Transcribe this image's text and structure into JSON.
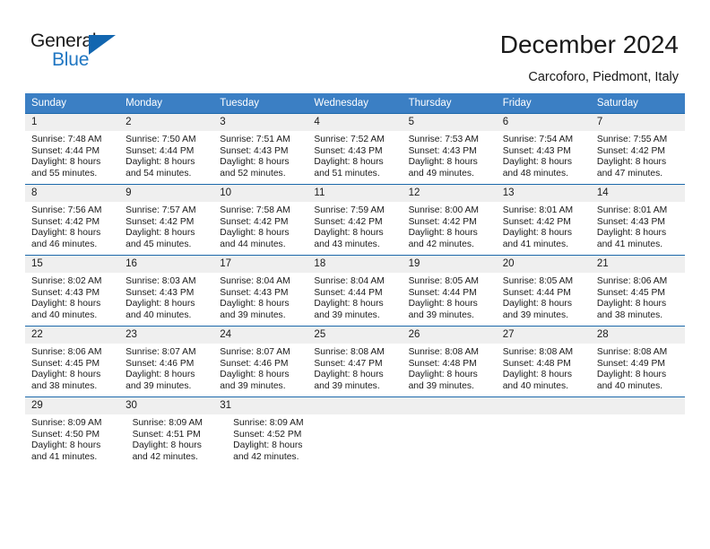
{
  "brand": {
    "word_one": "General",
    "word_two": "Blue",
    "triangle_icon": "triangle-icon",
    "accent_color": "#1266b0"
  },
  "header": {
    "title": "December 2024",
    "subtitle": "Carcoforo, Piedmont, Italy"
  },
  "calendar": {
    "header_bg": "#3b7fc4",
    "daynum_bg": "#efefef",
    "rule_color": "#1d69ab",
    "weekdays": [
      "Sunday",
      "Monday",
      "Tuesday",
      "Wednesday",
      "Thursday",
      "Friday",
      "Saturday"
    ],
    "weeks": [
      [
        {
          "day": "1",
          "sunrise": "Sunrise: 7:48 AM",
          "sunset": "Sunset: 4:44 PM",
          "daylight_line1": "Daylight: 8 hours",
          "daylight_line2": "and 55 minutes."
        },
        {
          "day": "2",
          "sunrise": "Sunrise: 7:50 AM",
          "sunset": "Sunset: 4:44 PM",
          "daylight_line1": "Daylight: 8 hours",
          "daylight_line2": "and 54 minutes."
        },
        {
          "day": "3",
          "sunrise": "Sunrise: 7:51 AM",
          "sunset": "Sunset: 4:43 PM",
          "daylight_line1": "Daylight: 8 hours",
          "daylight_line2": "and 52 minutes."
        },
        {
          "day": "4",
          "sunrise": "Sunrise: 7:52 AM",
          "sunset": "Sunset: 4:43 PM",
          "daylight_line1": "Daylight: 8 hours",
          "daylight_line2": "and 51 minutes."
        },
        {
          "day": "5",
          "sunrise": "Sunrise: 7:53 AM",
          "sunset": "Sunset: 4:43 PM",
          "daylight_line1": "Daylight: 8 hours",
          "daylight_line2": "and 49 minutes."
        },
        {
          "day": "6",
          "sunrise": "Sunrise: 7:54 AM",
          "sunset": "Sunset: 4:43 PM",
          "daylight_line1": "Daylight: 8 hours",
          "daylight_line2": "and 48 minutes."
        },
        {
          "day": "7",
          "sunrise": "Sunrise: 7:55 AM",
          "sunset": "Sunset: 4:42 PM",
          "daylight_line1": "Daylight: 8 hours",
          "daylight_line2": "and 47 minutes."
        }
      ],
      [
        {
          "day": "8",
          "sunrise": "Sunrise: 7:56 AM",
          "sunset": "Sunset: 4:42 PM",
          "daylight_line1": "Daylight: 8 hours",
          "daylight_line2": "and 46 minutes."
        },
        {
          "day": "9",
          "sunrise": "Sunrise: 7:57 AM",
          "sunset": "Sunset: 4:42 PM",
          "daylight_line1": "Daylight: 8 hours",
          "daylight_line2": "and 45 minutes."
        },
        {
          "day": "10",
          "sunrise": "Sunrise: 7:58 AM",
          "sunset": "Sunset: 4:42 PM",
          "daylight_line1": "Daylight: 8 hours",
          "daylight_line2": "and 44 minutes."
        },
        {
          "day": "11",
          "sunrise": "Sunrise: 7:59 AM",
          "sunset": "Sunset: 4:42 PM",
          "daylight_line1": "Daylight: 8 hours",
          "daylight_line2": "and 43 minutes."
        },
        {
          "day": "12",
          "sunrise": "Sunrise: 8:00 AM",
          "sunset": "Sunset: 4:42 PM",
          "daylight_line1": "Daylight: 8 hours",
          "daylight_line2": "and 42 minutes."
        },
        {
          "day": "13",
          "sunrise": "Sunrise: 8:01 AM",
          "sunset": "Sunset: 4:42 PM",
          "daylight_line1": "Daylight: 8 hours",
          "daylight_line2": "and 41 minutes."
        },
        {
          "day": "14",
          "sunrise": "Sunrise: 8:01 AM",
          "sunset": "Sunset: 4:43 PM",
          "daylight_line1": "Daylight: 8 hours",
          "daylight_line2": "and 41 minutes."
        }
      ],
      [
        {
          "day": "15",
          "sunrise": "Sunrise: 8:02 AM",
          "sunset": "Sunset: 4:43 PM",
          "daylight_line1": "Daylight: 8 hours",
          "daylight_line2": "and 40 minutes."
        },
        {
          "day": "16",
          "sunrise": "Sunrise: 8:03 AM",
          "sunset": "Sunset: 4:43 PM",
          "daylight_line1": "Daylight: 8 hours",
          "daylight_line2": "and 40 minutes."
        },
        {
          "day": "17",
          "sunrise": "Sunrise: 8:04 AM",
          "sunset": "Sunset: 4:43 PM",
          "daylight_line1": "Daylight: 8 hours",
          "daylight_line2": "and 39 minutes."
        },
        {
          "day": "18",
          "sunrise": "Sunrise: 8:04 AM",
          "sunset": "Sunset: 4:44 PM",
          "daylight_line1": "Daylight: 8 hours",
          "daylight_line2": "and 39 minutes."
        },
        {
          "day": "19",
          "sunrise": "Sunrise: 8:05 AM",
          "sunset": "Sunset: 4:44 PM",
          "daylight_line1": "Daylight: 8 hours",
          "daylight_line2": "and 39 minutes."
        },
        {
          "day": "20",
          "sunrise": "Sunrise: 8:05 AM",
          "sunset": "Sunset: 4:44 PM",
          "daylight_line1": "Daylight: 8 hours",
          "daylight_line2": "and 39 minutes."
        },
        {
          "day": "21",
          "sunrise": "Sunrise: 8:06 AM",
          "sunset": "Sunset: 4:45 PM",
          "daylight_line1": "Daylight: 8 hours",
          "daylight_line2": "and 38 minutes."
        }
      ],
      [
        {
          "day": "22",
          "sunrise": "Sunrise: 8:06 AM",
          "sunset": "Sunset: 4:45 PM",
          "daylight_line1": "Daylight: 8 hours",
          "daylight_line2": "and 38 minutes."
        },
        {
          "day": "23",
          "sunrise": "Sunrise: 8:07 AM",
          "sunset": "Sunset: 4:46 PM",
          "daylight_line1": "Daylight: 8 hours",
          "daylight_line2": "and 39 minutes."
        },
        {
          "day": "24",
          "sunrise": "Sunrise: 8:07 AM",
          "sunset": "Sunset: 4:46 PM",
          "daylight_line1": "Daylight: 8 hours",
          "daylight_line2": "and 39 minutes."
        },
        {
          "day": "25",
          "sunrise": "Sunrise: 8:08 AM",
          "sunset": "Sunset: 4:47 PM",
          "daylight_line1": "Daylight: 8 hours",
          "daylight_line2": "and 39 minutes."
        },
        {
          "day": "26",
          "sunrise": "Sunrise: 8:08 AM",
          "sunset": "Sunset: 4:48 PM",
          "daylight_line1": "Daylight: 8 hours",
          "daylight_line2": "and 39 minutes."
        },
        {
          "day": "27",
          "sunrise": "Sunrise: 8:08 AM",
          "sunset": "Sunset: 4:48 PM",
          "daylight_line1": "Daylight: 8 hours",
          "daylight_line2": "and 40 minutes."
        },
        {
          "day": "28",
          "sunrise": "Sunrise: 8:08 AM",
          "sunset": "Sunset: 4:49 PM",
          "daylight_line1": "Daylight: 8 hours",
          "daylight_line2": "and 40 minutes."
        }
      ],
      [
        {
          "day": "29",
          "sunrise": "Sunrise: 8:09 AM",
          "sunset": "Sunset: 4:50 PM",
          "daylight_line1": "Daylight: 8 hours",
          "daylight_line2": "and 41 minutes."
        },
        {
          "day": "30",
          "sunrise": "Sunrise: 8:09 AM",
          "sunset": "Sunset: 4:51 PM",
          "daylight_line1": "Daylight: 8 hours",
          "daylight_line2": "and 42 minutes."
        },
        {
          "day": "31",
          "sunrise": "Sunrise: 8:09 AM",
          "sunset": "Sunset: 4:52 PM",
          "daylight_line1": "Daylight: 8 hours",
          "daylight_line2": "and 42 minutes."
        },
        {
          "day": "",
          "sunrise": "",
          "sunset": "",
          "daylight_line1": "",
          "daylight_line2": ""
        },
        {
          "day": "",
          "sunrise": "",
          "sunset": "",
          "daylight_line1": "",
          "daylight_line2": ""
        },
        {
          "day": "",
          "sunrise": "",
          "sunset": "",
          "daylight_line1": "",
          "daylight_line2": ""
        },
        {
          "day": "",
          "sunrise": "",
          "sunset": "",
          "daylight_line1": "",
          "daylight_line2": ""
        }
      ]
    ]
  }
}
